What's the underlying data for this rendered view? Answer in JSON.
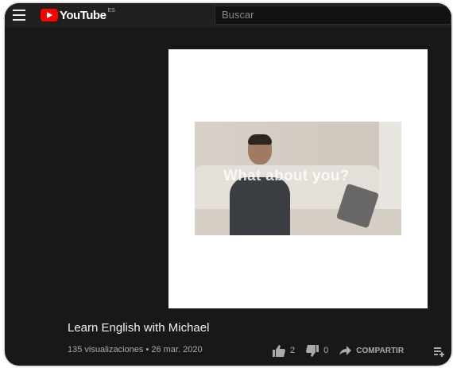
{
  "header": {
    "logo_text": "YouTube",
    "country_code": "ES",
    "search_placeholder": "Buscar"
  },
  "player": {
    "caption": "What about you?"
  },
  "video": {
    "title": "Learn English with Michael",
    "meta": "135 visualizaciones • 26 mar. 2020",
    "likes": "2",
    "dislikes": "0",
    "share_label": "COMPARTIR"
  },
  "colors": {
    "background": "#181818",
    "topbar": "#202020",
    "brand_red": "#ff0000",
    "text_primary": "#f1f1f1",
    "text_secondary": "#aaaaaa"
  },
  "icons": [
    "menu-icon",
    "youtube-logo-icon",
    "thumbs-up-icon",
    "thumbs-down-icon",
    "share-icon",
    "add-to-playlist-icon"
  ]
}
